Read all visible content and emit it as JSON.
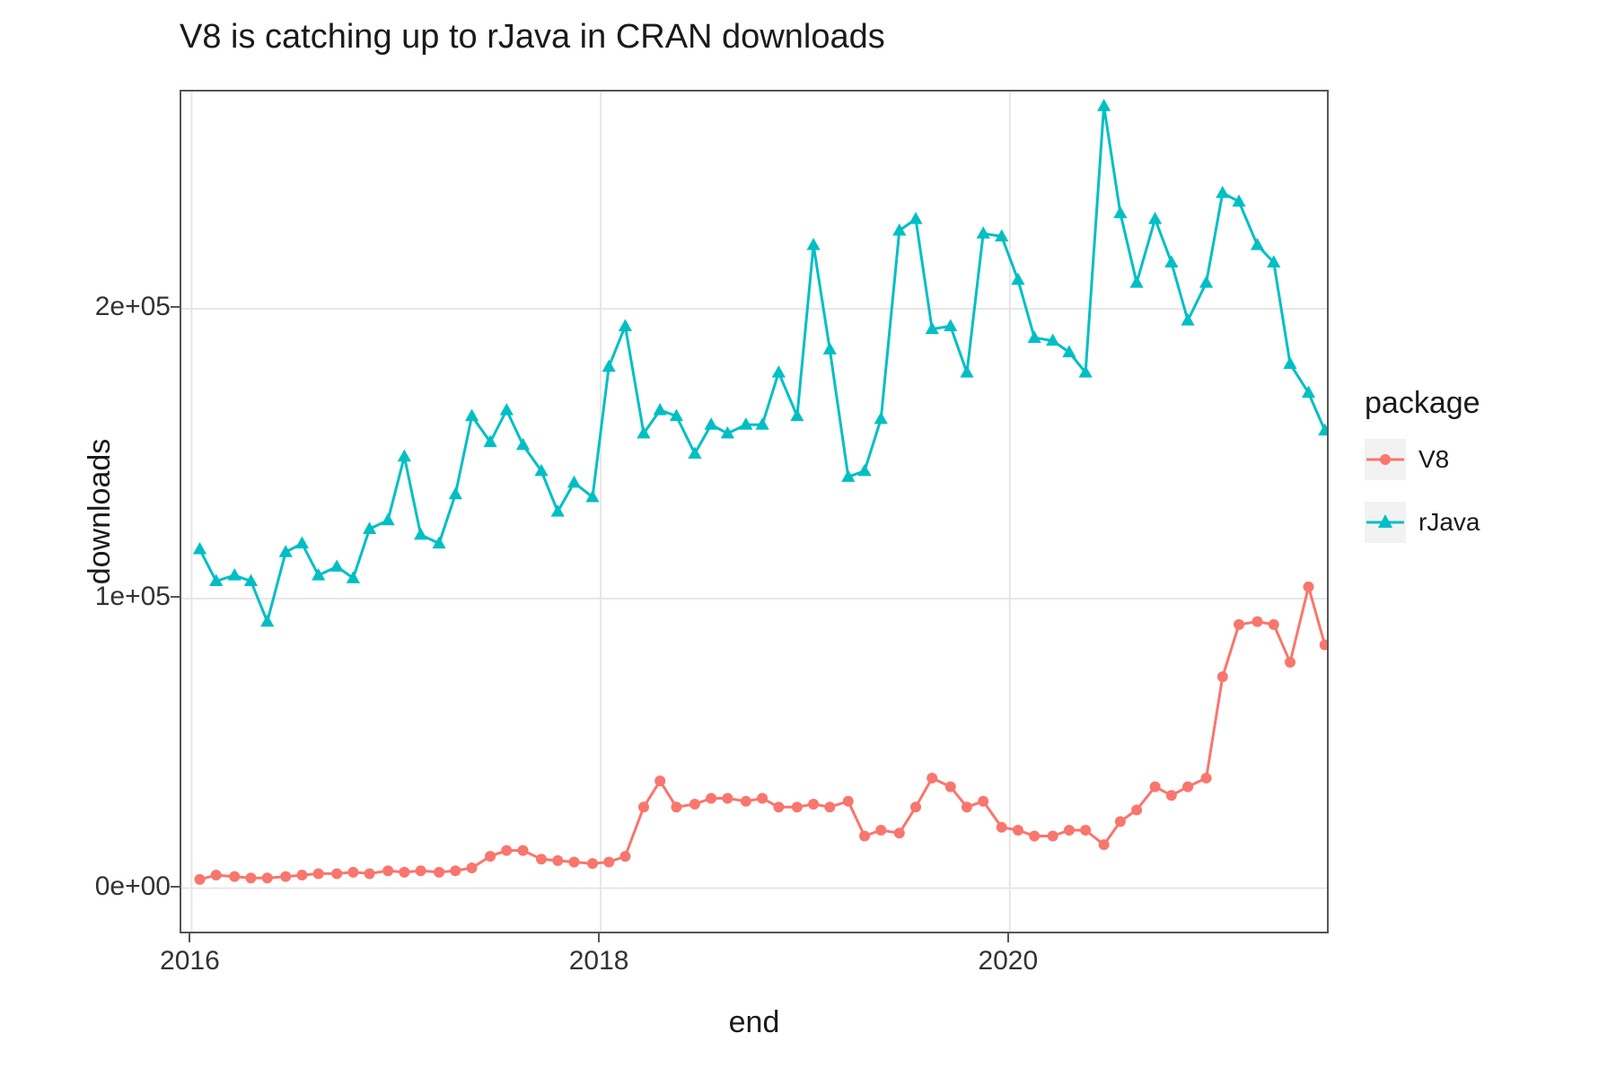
{
  "chart_data": {
    "type": "line",
    "title": "V8 is catching up to rJava in CRAN downloads",
    "xlabel": "end",
    "ylabel": "downloads",
    "legend_title": "package",
    "legend_position": "right",
    "grid": true,
    "x_type": "date-year-fraction",
    "x_range": [
      2015.95,
      2021.55
    ],
    "y_range": [
      -15000,
      275000
    ],
    "x_ticks": [
      2016,
      2018,
      2020
    ],
    "y_ticks": [
      0,
      100000,
      200000
    ],
    "y_tick_labels": [
      "0e+00",
      "1e+05",
      "2e+05"
    ],
    "colors": {
      "V8": "#F8766D",
      "rJava": "#00BFC4"
    },
    "markers": {
      "V8": "circle",
      "rJava": "triangle-up"
    },
    "x": [
      2016.04,
      2016.12,
      2016.21,
      2016.29,
      2016.37,
      2016.46,
      2016.54,
      2016.62,
      2016.71,
      2016.79,
      2016.87,
      2016.96,
      2017.04,
      2017.12,
      2017.21,
      2017.29,
      2017.37,
      2017.46,
      2017.54,
      2017.62,
      2017.71,
      2017.79,
      2017.87,
      2017.96,
      2018.04,
      2018.12,
      2018.21,
      2018.29,
      2018.37,
      2018.46,
      2018.54,
      2018.62,
      2018.71,
      2018.79,
      2018.87,
      2018.96,
      2019.04,
      2019.12,
      2019.21,
      2019.29,
      2019.37,
      2019.46,
      2019.54,
      2019.62,
      2019.71,
      2019.79,
      2019.87,
      2019.96,
      2020.04,
      2020.12,
      2020.21,
      2020.29,
      2020.37,
      2020.46,
      2020.54,
      2020.62,
      2020.71,
      2020.79,
      2020.87,
      2020.96,
      2021.04,
      2021.12,
      2021.21,
      2021.29,
      2021.37,
      2021.46
    ],
    "series": [
      {
        "name": "V8",
        "values": [
          3000,
          4500,
          4000,
          3500,
          3500,
          4000,
          4500,
          5000,
          5000,
          5500,
          5000,
          6000,
          5500,
          6000,
          5500,
          6000,
          7000,
          11000,
          13000,
          13000,
          10000,
          9500,
          9000,
          8500,
          9000,
          11000,
          28000,
          37000,
          28000,
          29000,
          31000,
          31000,
          30000,
          31000,
          28000,
          28000,
          29000,
          28000,
          30000,
          18000,
          20000,
          19000,
          28000,
          38000,
          35000,
          28000,
          30000,
          21000,
          20000,
          18000,
          18000,
          20000,
          20000,
          15000,
          23000,
          27000,
          35000,
          32000,
          35000,
          38000,
          73000,
          91000,
          92000,
          91000,
          78000,
          104000
        ]
      },
      {
        "name": "rJava",
        "values": [
          117000,
          106000,
          108000,
          106000,
          92000,
          116000,
          119000,
          108000,
          111000,
          107000,
          124000,
          127000,
          149000,
          122000,
          119000,
          136000,
          163000,
          154000,
          165000,
          153000,
          144000,
          130000,
          140000,
          135000,
          180000,
          194000,
          157000,
          165000,
          163000,
          150000,
          160000,
          157000,
          160000,
          160000,
          178000,
          163000,
          222000,
          186000,
          142000,
          144000,
          162000,
          227000,
          231000,
          193000,
          194000,
          178000,
          226000,
          225000,
          210000,
          190000,
          189000,
          185000,
          178000,
          270000,
          233000,
          209000,
          231000,
          216000,
          196000,
          209000,
          240000,
          237000,
          222000,
          216000,
          181000,
          171000
        ]
      }
    ]
  },
  "last_point_hint": {
    "V8": 84000,
    "rJava": 158000
  }
}
